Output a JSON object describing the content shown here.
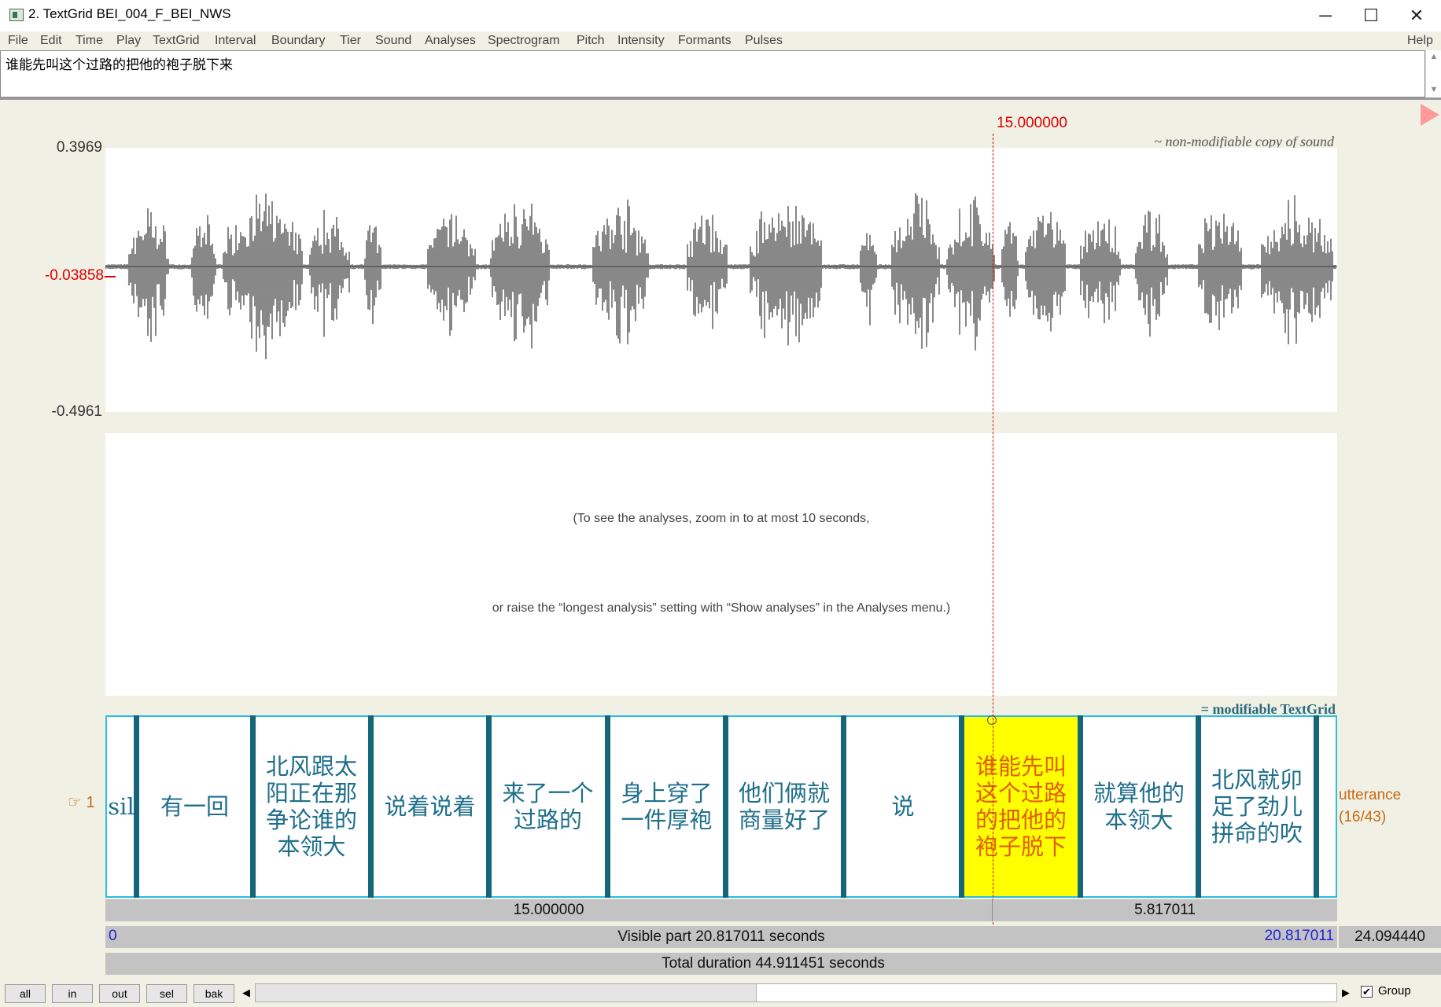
{
  "window": {
    "title": "2. TextGrid BEI_004_F_BEI_NWS",
    "controls": [
      "─",
      "☐",
      "✕"
    ]
  },
  "menu": {
    "items": [
      "File",
      "Edit",
      "Time",
      "Play",
      "TextGrid",
      "Interval",
      "Boundary",
      "Tier",
      "Sound",
      "Analyses",
      "Spectrogram",
      "Pitch",
      "Intensity",
      "Formants",
      "Pulses"
    ],
    "help": "Help"
  },
  "text_field": {
    "value": "谁能先叫这个过路的把他的袍子脱下来"
  },
  "sound": {
    "caption": "~ non-modifiable copy of sound",
    "y_max": "0.3969",
    "y_cursor": "-0.03858",
    "y_min": "-0.4961"
  },
  "analyses": {
    "message_line1": "(To see the analyses, zoom in to at most 10 seconds,",
    "message_line2": "or raise the “longest analysis” setting with “Show analyses” in the Analyses menu.)"
  },
  "cursor": {
    "time": "15.000000"
  },
  "textgrid": {
    "caption": "= modifiable TextGrid",
    "tier_number": "1",
    "tier_name": "utterance",
    "tier_count": "(16/43)",
    "intervals": [
      {
        "text": "sil",
        "selected": false
      },
      {
        "text": "有一回",
        "selected": false
      },
      {
        "text": "北风跟太阳正在那争论谁的本领大",
        "selected": false
      },
      {
        "text": "说着说着",
        "selected": false
      },
      {
        "text": "来了一个过路的",
        "selected": false
      },
      {
        "text": "身上穿了一件厚袍",
        "selected": false
      },
      {
        "text": "他们俩就商量好了",
        "selected": false
      },
      {
        "text": "说",
        "selected": false
      },
      {
        "text": "谁能先叫这个过路的把他的袍子脱下",
        "selected": true
      },
      {
        "text": "就算他的本领大",
        "selected": false
      },
      {
        "text": "北风就卯足了劲儿拼命的吹",
        "selected": false
      }
    ]
  },
  "time_bars": {
    "left_segment": "15.000000",
    "right_segment": "5.817011",
    "visible_start": "0",
    "visible_label": "Visible part 20.817011 seconds",
    "visible_end": "20.817011",
    "right_remaining": "24.094440",
    "total_label": "Total duration 44.911451 seconds"
  },
  "bottom": {
    "buttons": [
      "all",
      "in",
      "out",
      "sel",
      "bak"
    ],
    "group_label": "Group",
    "group_checked": "✔"
  }
}
